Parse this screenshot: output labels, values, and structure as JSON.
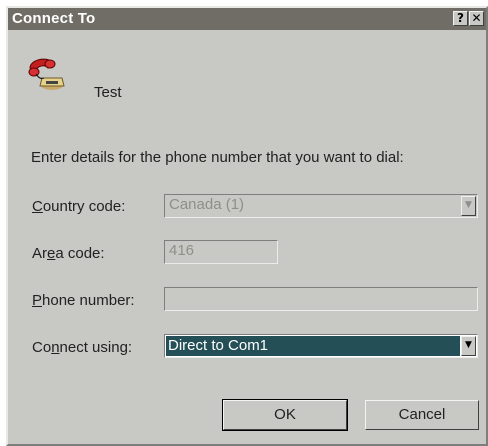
{
  "window": {
    "title": "Connect To",
    "help_glyph": "?",
    "close_glyph": "✕"
  },
  "connection": {
    "icon": "telephone-icon",
    "name": "Test"
  },
  "instructions": "Enter details for the phone number that you want to dial:",
  "fields": {
    "country": {
      "label_access": "C",
      "label_rest": "ountry code:",
      "value": "Canada (1)",
      "enabled": false
    },
    "area": {
      "label_pre": "Ar",
      "label_access": "e",
      "label_rest": "a code:",
      "value": "416",
      "enabled": false
    },
    "phone": {
      "label_access": "P",
      "label_rest": "hone number:",
      "value": "",
      "enabled": true
    },
    "connect": {
      "label_pre": "Co",
      "label_access": "n",
      "label_rest": "nect using:",
      "value": "Direct to Com1",
      "enabled": true
    }
  },
  "buttons": {
    "ok": "OK",
    "cancel": "Cancel"
  },
  "dropdown_glyph": "▼",
  "colors": {
    "titlebar": "#6f6d65",
    "dialog": "#c8c8c4",
    "selection": "#244f57"
  }
}
